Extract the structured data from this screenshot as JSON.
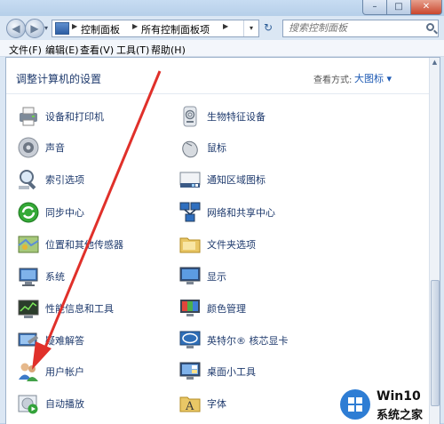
{
  "breadcrumbs": [
    "控制面板",
    "所有控制面板项"
  ],
  "search": {
    "placeholder": "搜索控制面板"
  },
  "menu": [
    "文件(F)",
    "编辑(E)",
    "查看(V)",
    "工具(T)",
    "帮助(H)"
  ],
  "page": {
    "heading": "调整计算机的设置",
    "view_label": "查看方式:",
    "view_value": "大图标 ▾"
  },
  "items_left": [
    {
      "label": "设备和打印机",
      "icon": "printer-icon"
    },
    {
      "label": "声音",
      "icon": "speaker-icon"
    },
    {
      "label": "索引选项",
      "icon": "magnifier-icon"
    },
    {
      "label": "同步中心",
      "icon": "sync-icon"
    },
    {
      "label": "位置和其他传感器",
      "icon": "location-icon"
    },
    {
      "label": "系统",
      "icon": "computer-icon"
    },
    {
      "label": "性能信息和工具",
      "icon": "performance-icon"
    },
    {
      "label": "疑难解答",
      "icon": "troubleshoot-icon"
    },
    {
      "label": "用户帐户",
      "icon": "users-icon"
    },
    {
      "label": "自动播放",
      "icon": "autoplay-icon"
    }
  ],
  "items_right": [
    {
      "label": "生物特征设备",
      "icon": "fingerprint-icon"
    },
    {
      "label": "鼠标",
      "icon": "mouse-icon"
    },
    {
      "label": "通知区域图标",
      "icon": "notification-icon"
    },
    {
      "label": "网络和共享中心",
      "icon": "network-icon"
    },
    {
      "label": "文件夹选项",
      "icon": "folder-icon"
    },
    {
      "label": "显示",
      "icon": "display-icon"
    },
    {
      "label": "颜色管理",
      "icon": "color-icon"
    },
    {
      "label": "英特尔® 核芯显卡",
      "icon": "intel-icon"
    },
    {
      "label": "桌面小工具",
      "icon": "gadgets-icon"
    },
    {
      "label": "字体",
      "icon": "font-icon"
    }
  ],
  "watermark": {
    "line1": "Win10",
    "line2": "系统之家"
  },
  "colors": {
    "accent": "#1e3a6d",
    "arrow": "#e0302a",
    "brand": "#2e7dd4"
  }
}
